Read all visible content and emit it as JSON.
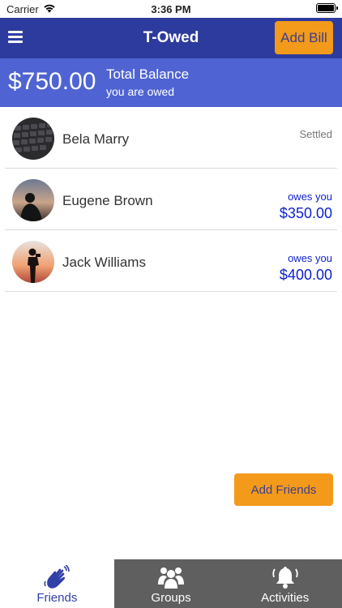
{
  "status_bar": {
    "carrier": "Carrier",
    "time": "3:36 PM"
  },
  "nav": {
    "title": "T-Owed",
    "add_bill_label": "Add Bill"
  },
  "balance": {
    "amount": "$750.00",
    "label": "Total Balance",
    "sublabel": "you are owed"
  },
  "friends": [
    {
      "name": "Bela Marry",
      "status": "Settled",
      "owes_label": "",
      "amount": ""
    },
    {
      "name": "Eugene Brown",
      "status": "",
      "owes_label": "owes you",
      "amount": "$350.00"
    },
    {
      "name": "Jack Williams",
      "status": "",
      "owes_label": "owes you",
      "amount": "$400.00"
    }
  ],
  "add_friends_label": "Add Friends",
  "tabs": [
    {
      "label": "Friends",
      "icon": "waving-hand-icon",
      "active": true
    },
    {
      "label": "Groups",
      "icon": "group-icon",
      "active": false
    },
    {
      "label": "Activities",
      "icon": "bell-icon",
      "active": false
    }
  ],
  "colors": {
    "nav_bar": "#2d3b9e",
    "balance_header": "#4f64d2",
    "accent_button": "#f39a1b",
    "owed_text": "#0b1fd0",
    "tab_inactive": "#5f5f5f"
  }
}
